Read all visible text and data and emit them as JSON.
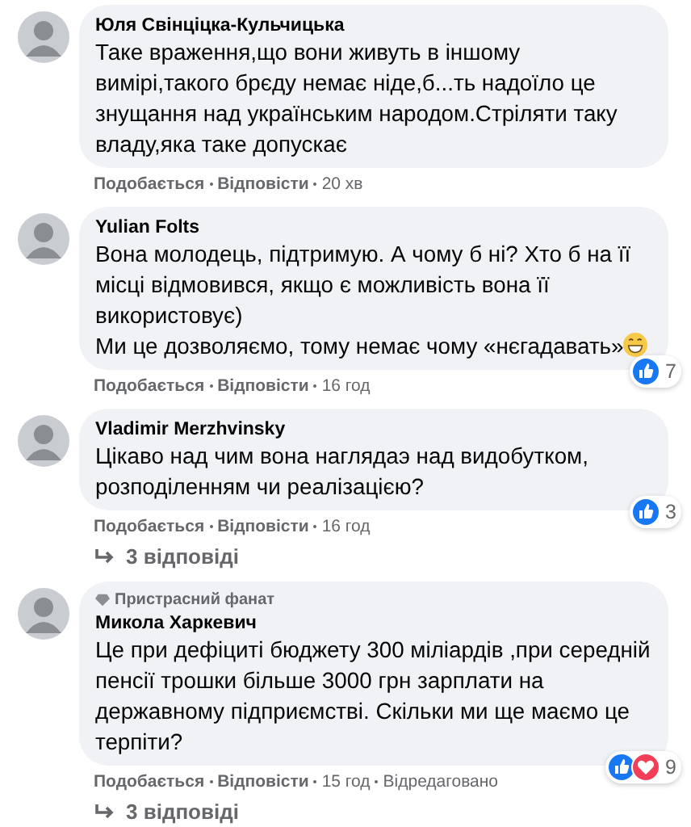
{
  "comments": [
    {
      "author": "Юля Свінціцка-Кульчицька",
      "paragraphs": [
        {
          "text": "Таке враження,що вони живуть в іншому вимірі,такого брєду немає ніде,б...ть надоїло це знущання над українським народом.Стріляти таку владу,яка таке допускає",
          "trailing_emoji": false
        }
      ],
      "like": "Подобається",
      "reply": "Відповісти",
      "time": "20 хв"
    },
    {
      "author": "Yulian Folts",
      "paragraphs": [
        {
          "text": "Вона молодець, підтримую. А чому б ні? Хто б на її місці відмовився, якщо є можливість вона її використовує)",
          "trailing_emoji": false
        },
        {
          "text": "Ми це дозволяємо, тому немає чому «нєгадавать»",
          "trailing_emoji": true
        }
      ],
      "reactions": [
        {
          "kind": "like"
        }
      ],
      "reaction_count": "7",
      "like": "Подобається",
      "reply": "Відповісти",
      "time": "16 год"
    },
    {
      "author": "Vladimir Merzhvinsky",
      "paragraphs": [
        {
          "text": "Цікаво над чим вона наглядаэ над видобутком, розподіленням чи реалізацією?",
          "trailing_emoji": false
        }
      ],
      "reactions": [
        {
          "kind": "like"
        }
      ],
      "reaction_count": "3",
      "like": "Подобається",
      "reply": "Відповісти",
      "time": "16 год",
      "replies": "3 відповіді"
    },
    {
      "badge": "Пристрасний фанат",
      "author": "Микола Харкевич",
      "paragraphs": [
        {
          "text": "Це при дефіциті бюджету 300 міліардів ,при середній пенсії трошки більше 3000 грн зарплати на державному підприємстві. Скільки ми ще маємо це терпіти?",
          "trailing_emoji": false
        }
      ],
      "reactions": [
        {
          "kind": "like"
        },
        {
          "kind": "love"
        }
      ],
      "reaction_count": "9",
      "like": "Подобається",
      "reply": "Відповісти",
      "time": "15 год",
      "edited": "Відредаговано",
      "replies": "3 відповіді"
    }
  ]
}
